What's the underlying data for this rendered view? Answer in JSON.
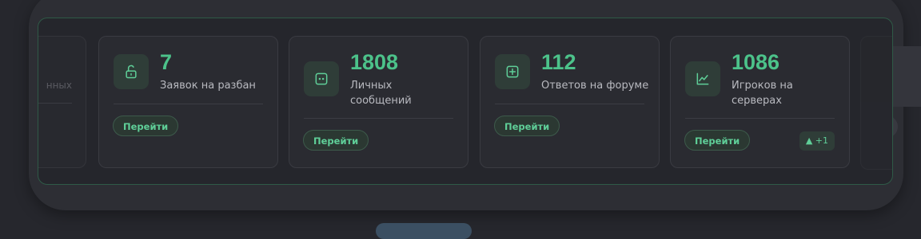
{
  "partial_left_card": {
    "label": "нных"
  },
  "cards": [
    {
      "icon": "lock-open-icon",
      "value": "7",
      "label": "Заявок на разбан",
      "button": "Перейти"
    },
    {
      "icon": "message-square-icon",
      "value": "1808",
      "label": "Личных сообщений",
      "button": "Перейти"
    },
    {
      "icon": "plus-square-icon",
      "value": "112",
      "label": "Ответов на форуме",
      "button": "Перейти"
    },
    {
      "icon": "line-chart-icon",
      "value": "1086",
      "label": "Игроков на серверах",
      "button": "Перейти",
      "trend": "▲ +1"
    }
  ],
  "colors": {
    "accent": "#4cc28a",
    "panel_border": "#2f5a47",
    "background": "#26272d"
  }
}
